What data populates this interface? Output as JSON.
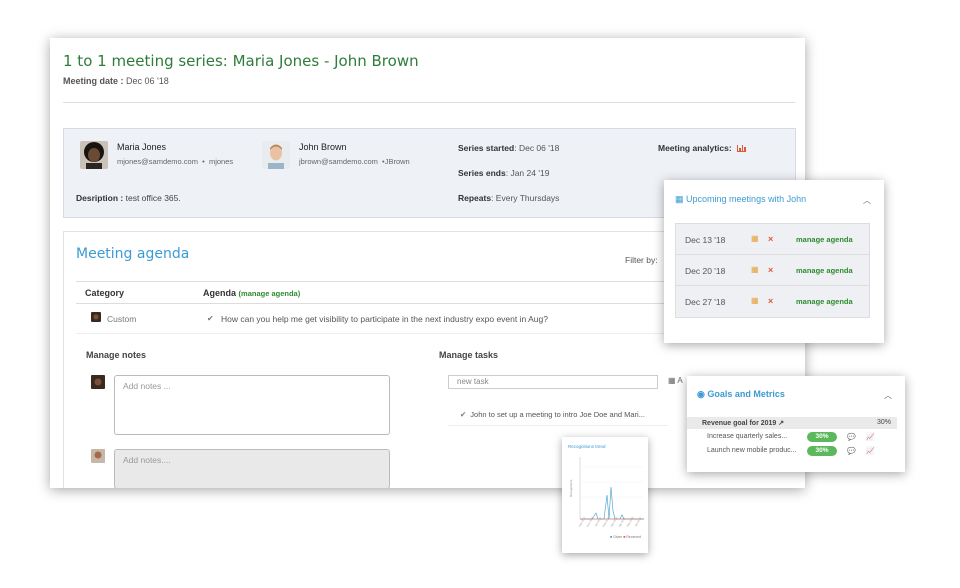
{
  "header": {
    "title": "1 to 1 meeting series: Maria Jones - John Brown",
    "meeting_date_label": "Meeting date :",
    "meeting_date_value": "Dec 06 '18"
  },
  "participants": [
    {
      "name": "Maria Jones",
      "email": "mjones@samdemo.com",
      "handle": "mjones"
    },
    {
      "name": "John Brown",
      "email": "jbrown@samdemo.com",
      "handle": "JBrown"
    }
  ],
  "description": {
    "label": "Desription :",
    "value": "test office 365."
  },
  "series": {
    "started_label": "Series started",
    "started_value": ": Dec 06 '18",
    "ends_label": "Series ends",
    "ends_value": ": Jan 24 '19",
    "repeats_label": "Repeats",
    "repeats_value": ": Every Thursdays",
    "analytics_label": "Meeting analytics:",
    "analytics_icon": "bar-chart-icon"
  },
  "agenda": {
    "title": "Meeting agenda",
    "filter_label": "Filter by:",
    "col_category": "Category",
    "col_agenda": "Agenda",
    "manage_link": "(manage agenda)",
    "rows": [
      {
        "category": "Custom",
        "text": "How can you help me get visibility to participate in the next industry expo event in Aug?"
      }
    ]
  },
  "notes": {
    "label": "Manage notes",
    "placeholder_1": "Add notes ...",
    "placeholder_2": "Add notes...."
  },
  "tasks": {
    "label": "Manage tasks",
    "input_placeholder": "new task",
    "extra": "A",
    "items": [
      "John to set up a meeting to intro Joe Doe and Mari..."
    ]
  },
  "upcoming": {
    "title": "Upcoming meetings with John",
    "manage_label": "manage agenda",
    "rows": [
      {
        "date": "Dec 13 '18"
      },
      {
        "date": "Dec 20 '18"
      },
      {
        "date": "Dec 27 '18"
      }
    ]
  },
  "goals": {
    "title": "Goals and Metrics",
    "main_goal": "Revenue goal for 2019",
    "main_pct": "30%",
    "subs": [
      {
        "label": "Increase quarterly sales...",
        "pct": "30%"
      },
      {
        "label": "Launch new mobile produc...",
        "pct": "30%"
      }
    ]
  },
  "trend": {
    "title": "Recognitions trend",
    "legend_given": "Given",
    "legend_received": "Received",
    "colors": {
      "given": "#3b9bd4",
      "received": "#e0583a"
    }
  }
}
